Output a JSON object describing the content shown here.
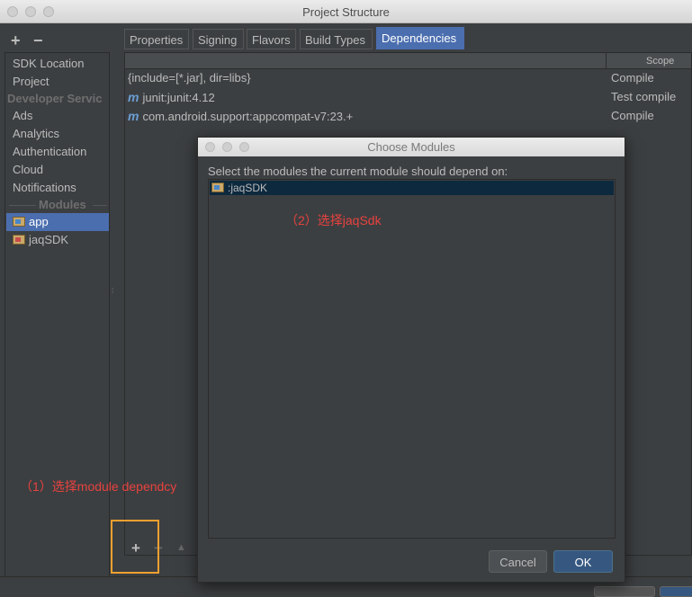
{
  "window": {
    "title": "Project Structure"
  },
  "left_panel": {
    "add_label": "+",
    "remove_label": "−",
    "items": [
      "SDK Location",
      "Project"
    ],
    "developer_header": "Developer Servic",
    "developer_items": [
      "Ads",
      "Analytics",
      "Authentication",
      "Cloud",
      "Notifications"
    ],
    "modules_header": "Modules",
    "modules": [
      {
        "label": "app",
        "selected": true
      },
      {
        "label": "jaqSDK",
        "selected": false
      }
    ]
  },
  "tabs": [
    {
      "label": "Properties",
      "active": false
    },
    {
      "label": "Signing",
      "active": false
    },
    {
      "label": "Flavors",
      "active": false
    },
    {
      "label": "Build Types",
      "active": false
    },
    {
      "label": "Dependencies",
      "active": true
    }
  ],
  "dependencies": {
    "scope_header": "Scope",
    "rows": [
      {
        "badge": "",
        "name": "{include=[*.jar], dir=libs}",
        "scope": "Compile"
      },
      {
        "badge": "m",
        "name": "junit:junit:4.12",
        "scope": "Test compile"
      },
      {
        "badge": "m",
        "name": "com.android.support:appcompat-v7:23.+",
        "scope": "Compile"
      }
    ]
  },
  "bottom_tools": {
    "add_label": "+",
    "remove_label": "−",
    "up_label": "▲"
  },
  "annotations": {
    "step1": "（1）选择module dependcy",
    "step2": "（2）选择jaqSdk"
  },
  "dialog": {
    "title": "Choose Modules",
    "prompt": "Select the modules the current module should depend on:",
    "modules": [
      {
        "label": ":jaqSDK",
        "selected": true
      }
    ],
    "cancel_label": "Cancel",
    "ok_label": "OK"
  },
  "colors": {
    "selection": "#4b6eaf",
    "annotation": "#e8423f",
    "highlight_box": "#f0a030"
  },
  "icons": {
    "module": "module-folder-icon",
    "maven": "maven-m-icon"
  }
}
